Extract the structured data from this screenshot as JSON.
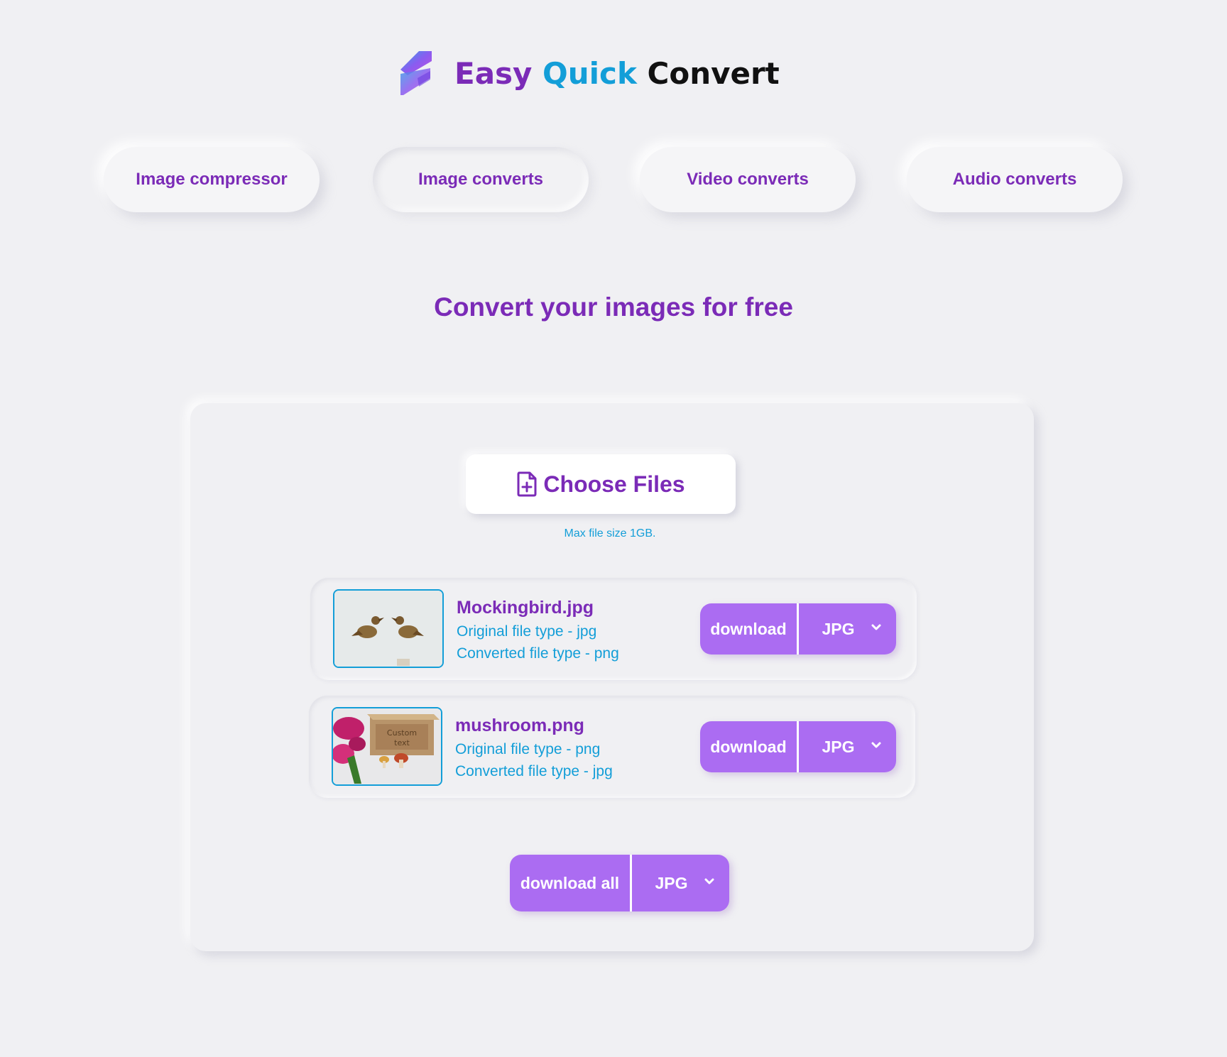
{
  "brand": {
    "word1": "Easy",
    "word2": "Quick",
    "word3": "Convert",
    "colors": {
      "purple": "#7b2bb7",
      "blue": "#139ed8",
      "dark": "#111111",
      "button": "#ab6cf2"
    }
  },
  "nav": {
    "items": [
      {
        "label": "Image compressor",
        "active": false
      },
      {
        "label": "Image converts",
        "active": true
      },
      {
        "label": "Video converts",
        "active": false
      },
      {
        "label": "Audio converts",
        "active": false
      }
    ]
  },
  "main": {
    "heading": "Convert your images for free",
    "choose_label": "Choose Files",
    "choose_icon": "file-plus-icon",
    "max_note": "Max file size 1GB."
  },
  "files": [
    {
      "name": "Mockingbird.jpg",
      "original": "Original file type - jpg",
      "converted": "Converted file type - png",
      "download_label": "download",
      "format": "JPG"
    },
    {
      "name": "mushroom.png",
      "original": "Original file type - png",
      "converted": "Converted file type - jpg",
      "download_label": "download",
      "format": "JPG"
    }
  ],
  "download_all": {
    "label": "download all",
    "format": "JPG"
  }
}
